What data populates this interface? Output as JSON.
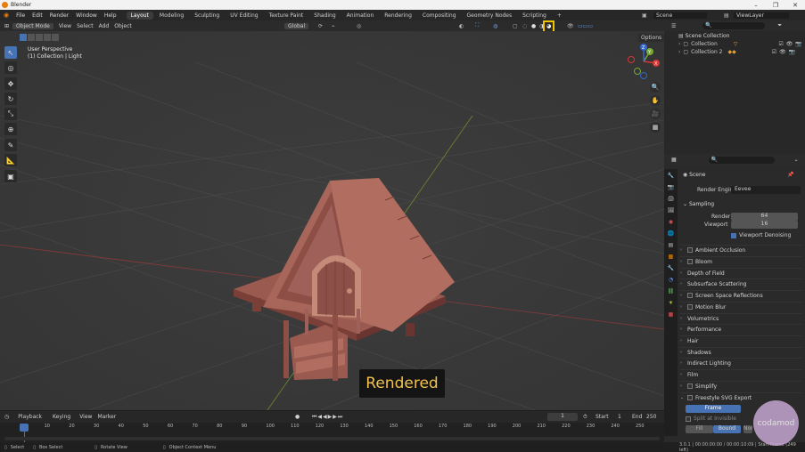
{
  "window": {
    "title": "Blender"
  },
  "menu": {
    "items": [
      "File",
      "Edit",
      "Render",
      "Window",
      "Help"
    ]
  },
  "workspaces": [
    "Layout",
    "Modeling",
    "Sculpting",
    "UV Editing",
    "Texture Paint",
    "Shading",
    "Animation",
    "Rendering",
    "Compositing",
    "Geometry Nodes",
    "Scripting"
  ],
  "workspace_add": "+",
  "scene": {
    "label": "Scene",
    "viewlayer": "ViewLayer"
  },
  "viewport_header": {
    "mode": "Object Mode",
    "view": "View",
    "select": "Select",
    "add": "Add",
    "object": "Object",
    "orientation": "Global",
    "options": "Options"
  },
  "viewport": {
    "perspective": "User Perspective",
    "context": "(1) Collection | Light",
    "caption": "Rendered"
  },
  "gizmo": {
    "x": "X",
    "y": "Y",
    "z": "Z"
  },
  "outliner": {
    "root": "Scene Collection",
    "items": [
      "Collection",
      "Collection 2"
    ]
  },
  "properties": {
    "context": "Scene",
    "render_engine_label": "Render Engine",
    "render_engine_value": "Eevee",
    "sampling": "Sampling",
    "render_label": "Render",
    "render_value": "64",
    "viewport_label": "Viewport",
    "viewport_value": "16",
    "denoise": "Viewport Denoising",
    "panels": [
      "Ambient Occlusion",
      "Bloom",
      "Depth of Field",
      "Subsurface Scattering",
      "Screen Space Reflections",
      "Motion Blur",
      "Volumetrics",
      "Performance",
      "Hair",
      "Shadows",
      "Indirect Lighting",
      "Film",
      "Simplify",
      "Freestyle SVG Export"
    ],
    "frame_btn": "Frame",
    "split_label": "Split at Invisible",
    "fill_btn": "Fill",
    "bound_btn": "Bound",
    "none_btn": "None"
  },
  "timeline": {
    "playback": "Playback",
    "keying": "Keying",
    "view": "View",
    "marker": "Marker",
    "current": "1",
    "start_label": "Start",
    "start": "1",
    "end_label": "End",
    "end": "250",
    "ticks": [
      "0",
      "10",
      "20",
      "30",
      "40",
      "50",
      "60",
      "70",
      "80",
      "90",
      "100",
      "110",
      "120",
      "130",
      "140",
      "150",
      "160",
      "170",
      "180",
      "190",
      "200",
      "210",
      "220",
      "230",
      "240",
      "250"
    ]
  },
  "status": {
    "select": "Select",
    "box": "Box Select",
    "rotate": "Rotate View",
    "context": "Object Context Menu",
    "version": "3.0.1 | 00:00:00:00 / 00:00:10:09 | Start Frame (249 left)"
  },
  "watermark": "codamod"
}
